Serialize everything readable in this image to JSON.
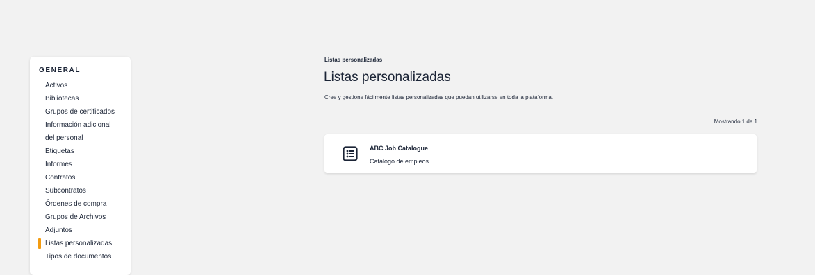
{
  "sidebar": {
    "heading": "GENERAL",
    "items": [
      {
        "label": "Activos"
      },
      {
        "label": "Bibliotecas"
      },
      {
        "label": "Grupos de certificados"
      },
      {
        "label": "Información adicional"
      },
      {
        "label": "del personal"
      },
      {
        "label": "Etiquetas"
      },
      {
        "label": "Informes"
      },
      {
        "label": "Contratos"
      },
      {
        "label": "Subcontratos"
      },
      {
        "label": "Órdenes de compra"
      },
      {
        "label": "Grupos de Archivos"
      },
      {
        "label": "Adjuntos"
      },
      {
        "label": "Listas personalizadas",
        "active": true
      },
      {
        "label": "Tipos de documentos"
      }
    ],
    "active_color": "#f39c12"
  },
  "main": {
    "breadcrumb": "Listas personalizadas",
    "title": "Listas personalizadas",
    "description": "Cree y gestione fácilmente listas personalizadas que puedan utilizarse en toda la plataforma.",
    "count_text": "Mostrando 1 de 1",
    "lists": [
      {
        "name": "ABC Job Catalogue",
        "subtitle": "Catálogo de empleos",
        "icon": "list-icon"
      }
    ]
  }
}
